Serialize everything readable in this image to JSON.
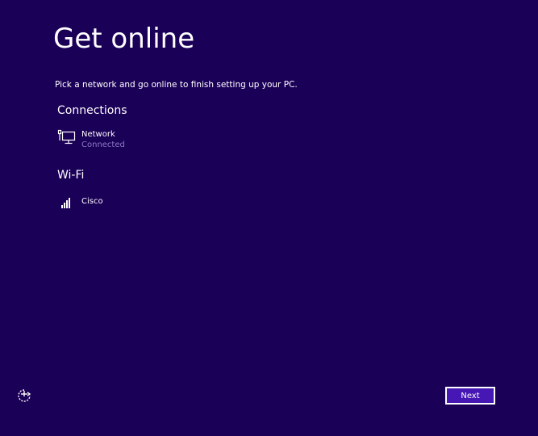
{
  "page": {
    "title": "Get online",
    "subtitle": "Pick a network and go online to finish setting up your PC."
  },
  "connections": {
    "heading": "Connections",
    "items": [
      {
        "name": "Network",
        "status": "Connected",
        "icon": "wired-network-icon"
      }
    ]
  },
  "wifi": {
    "heading": "Wi-Fi",
    "items": [
      {
        "name": "Cisco",
        "icon": "wifi-signal-icon"
      }
    ]
  },
  "footer": {
    "next_label": "Next",
    "ease_of_access_icon": "ease-of-access-icon"
  },
  "colors": {
    "background": "#1b0058",
    "button": "#4617b4",
    "status_text": "#8b7cc4"
  }
}
